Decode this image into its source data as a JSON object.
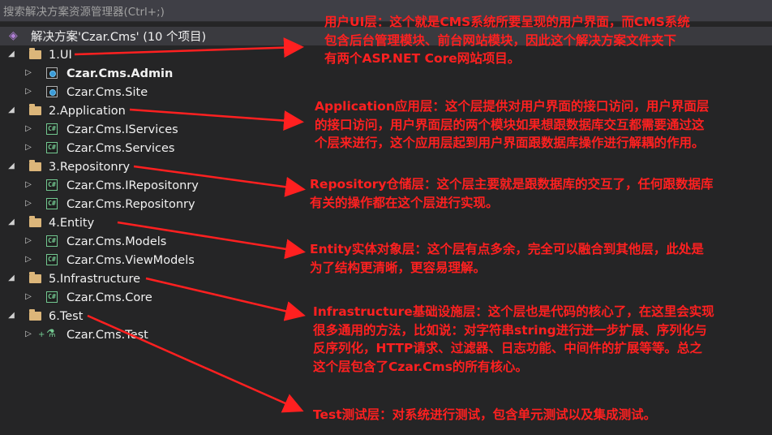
{
  "search": {
    "placeholder": "搜索解决方案资源管理器(Ctrl+;)"
  },
  "solution": {
    "label": "解决方案'Czar.Cms' (10 个项目)"
  },
  "tree": [
    {
      "label": "1.UI",
      "kind": "folder",
      "children": [
        {
          "label": "Czar.Cms.Admin",
          "kind": "web",
          "bold": true
        },
        {
          "label": "Czar.Cms.Site",
          "kind": "web",
          "bold": false
        }
      ]
    },
    {
      "label": "2.Application",
      "kind": "folder",
      "children": [
        {
          "label": "Czar.Cms.IServices",
          "kind": "csharp"
        },
        {
          "label": "Czar.Cms.Services",
          "kind": "csharp"
        }
      ]
    },
    {
      "label": "3.Repositonry",
      "kind": "folder",
      "children": [
        {
          "label": "Czar.Cms.IRepositonry",
          "kind": "csharp"
        },
        {
          "label": "Czar.Cms.Repositonry",
          "kind": "csharp"
        }
      ]
    },
    {
      "label": "4.Entity",
      "kind": "folder",
      "children": [
        {
          "label": "Czar.Cms.Models",
          "kind": "csharp"
        },
        {
          "label": "Czar.Cms.ViewModels",
          "kind": "csharp"
        }
      ]
    },
    {
      "label": "5.Infrastructure",
      "kind": "folder",
      "children": [
        {
          "label": "Czar.Cms.Core",
          "kind": "csharp"
        }
      ]
    },
    {
      "label": "6.Test",
      "kind": "folder",
      "children": [
        {
          "label": "Czar.Cms.Test",
          "kind": "test"
        }
      ]
    }
  ],
  "annotations": [
    {
      "lines": [
        "用户UI层：这个就是CMS系统所要呈现的用户界面，而CMS系统",
        "包含后台管理模块、前台网站模块，因此这个解决方案文件夹下",
        "有两个ASP.NET Core网站项目。"
      ]
    },
    {
      "lines": [
        "Application应用层：这个层提供对用户界面的接口访问，用户界面层",
        "的接口访问，用户界面层的两个模块如果想跟数据库交互都需要通过这",
        "个层来进行，这个应用层起到用户界面跟数据库操作进行解耦的作用。"
      ]
    },
    {
      "lines": [
        "Repository仓储层：这个层主要就是跟数据库的交互了，任何跟数据库",
        "有关的操作都在这个层进行实现。"
      ]
    },
    {
      "lines": [
        "Entity实体对象层：这个层有点多余，完全可以融合到其他层，此处是",
        "为了结构更清晰，更容易理解。"
      ]
    },
    {
      "lines": [
        "Infrastructure基础设施层：这个层也是代码的核心了，在这里会实现",
        "很多通用的方法，比如说：对字符串string进行进一步扩展、序列化与",
        "反序列化，HTTP请求、过滤器、日志功能、中间件的扩展等等。总之",
        "这个层包含了Czar.Cms的所有核心。"
      ]
    },
    {
      "lines": [
        "Test测试层：对系统进行测试，包含单元测试以及集成测试。"
      ]
    }
  ],
  "colors": {
    "annotation": "#ff2020",
    "background": "#252526",
    "folder": "#dcb67a"
  }
}
